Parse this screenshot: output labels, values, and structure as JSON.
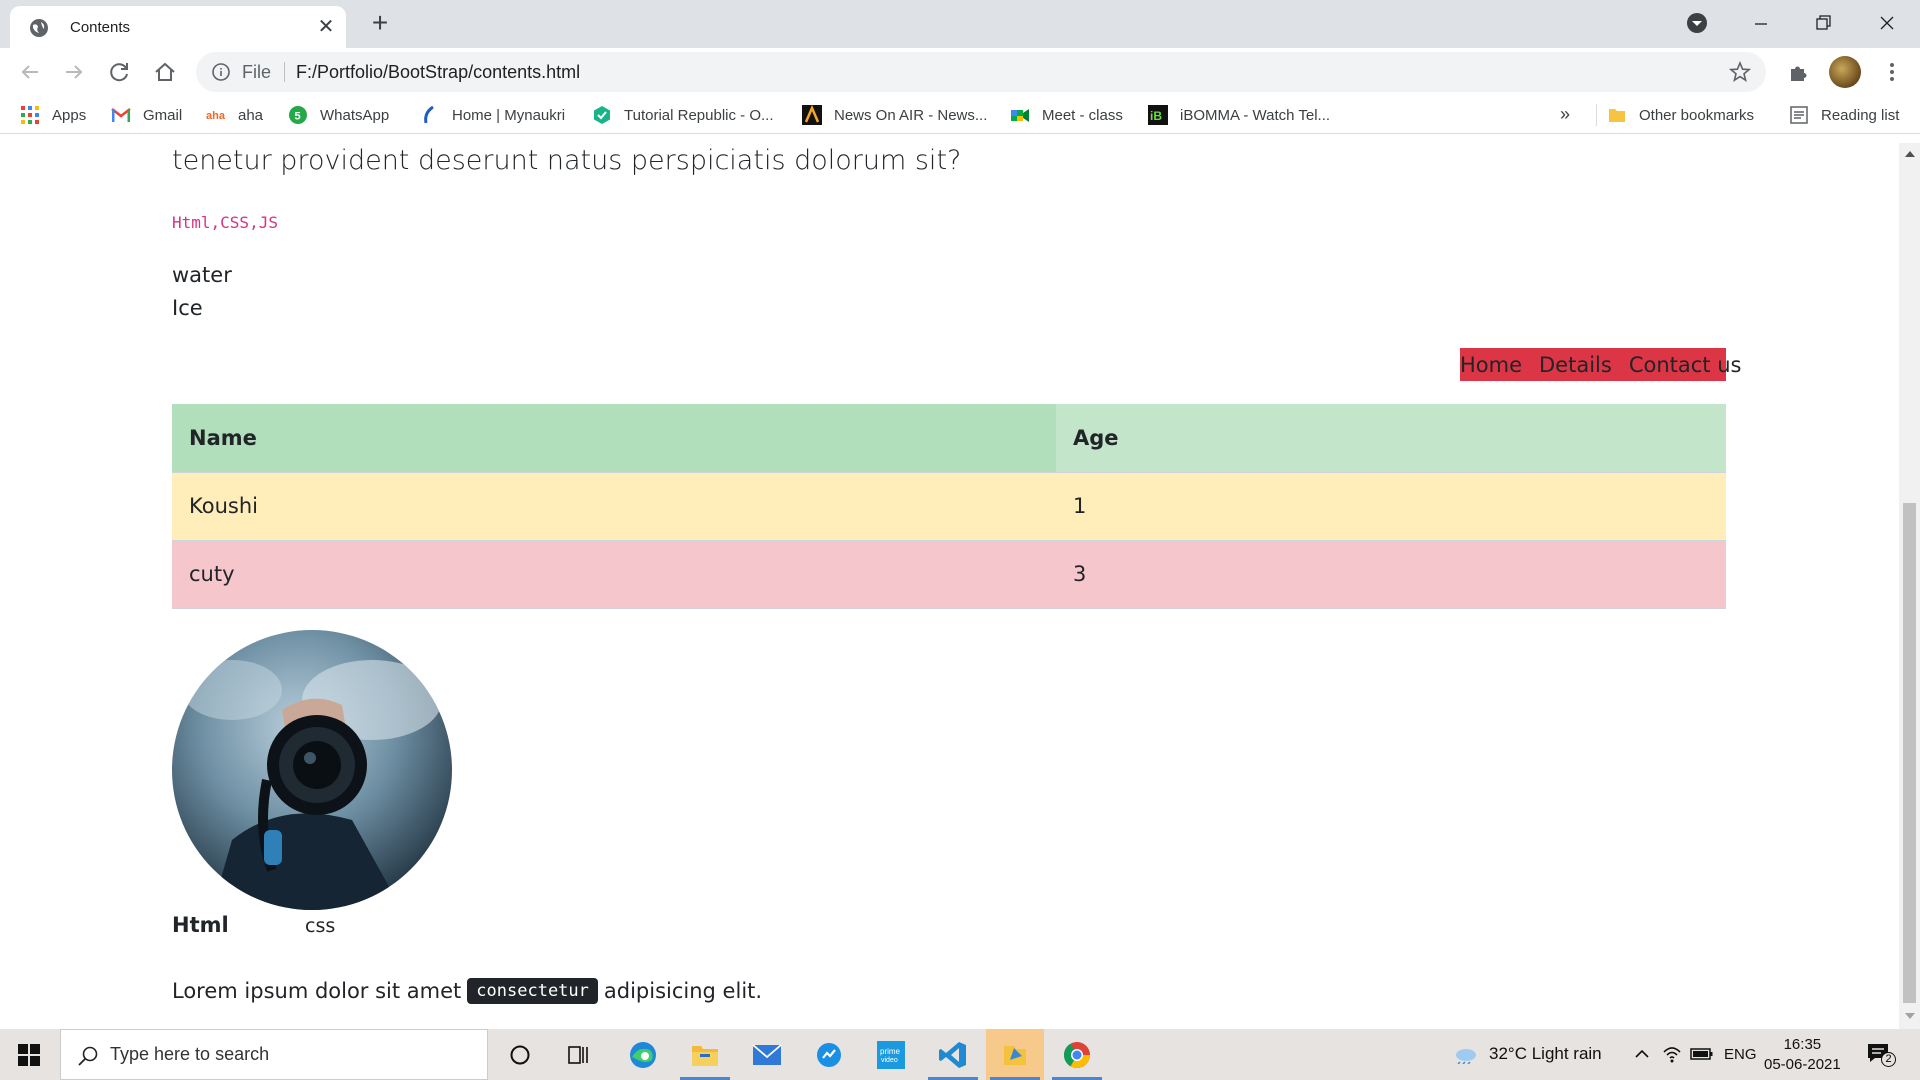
{
  "browser": {
    "tab_title": "Contents",
    "new_tab_symbol": "+",
    "close_symbol": "✕",
    "file_label": "File",
    "url": "F:/Portfolio/BootStrap/contents.html",
    "bookmarks": [
      {
        "label": "Apps",
        "icon": "apps-grid-icon"
      },
      {
        "label": "Gmail",
        "icon": "gmail-icon"
      },
      {
        "label": "aha",
        "icon": "aha-icon"
      },
      {
        "label": "WhatsApp",
        "icon": "whatsapp-icon"
      },
      {
        "label": "Home | Mynaukri",
        "icon": "mynaukri-icon"
      },
      {
        "label": "Tutorial Republic - O...",
        "icon": "tutorial-republic-icon"
      },
      {
        "label": "News On AIR - News...",
        "icon": "news-on-air-icon"
      },
      {
        "label": "Meet - class",
        "icon": "google-meet-icon"
      },
      {
        "label": "iBOMMA - Watch Tel...",
        "icon": "ibomma-icon"
      }
    ],
    "bookmarks_overflow": "»",
    "other_bookmarks": "Other bookmarks",
    "reading_list": "Reading list"
  },
  "page": {
    "lead": "tenetur provident deserunt natus perspiciatis dolorum sit?",
    "code": "Html,CSS,JS",
    "lines": [
      "water",
      "Ice"
    ],
    "nav": [
      "Home",
      "Details",
      "Contact us"
    ],
    "nav_bg": "#dc3545",
    "table": {
      "headers": [
        "Name",
        "Age"
      ],
      "header_colors": [
        "#b1dfbb",
        "#c3e6cb"
      ],
      "rows": [
        {
          "name": "Koushi",
          "age": "1",
          "color": "#ffeeba"
        },
        {
          "name": "cuty",
          "age": "3",
          "color": "#f5c6cb"
        }
      ]
    },
    "caption_bold": "Html",
    "caption_plain": "css",
    "lorem_before": "Lorem ipsum dolor sit amet",
    "lorem_kbd": "consectetur",
    "lorem_after": "adipisicing elit."
  },
  "taskbar": {
    "search_placeholder": "Type here to search",
    "weather": "32°C  Light rain",
    "language": "ENG",
    "time": "16:35",
    "date": "05-06-2021",
    "notification_count": "2"
  }
}
